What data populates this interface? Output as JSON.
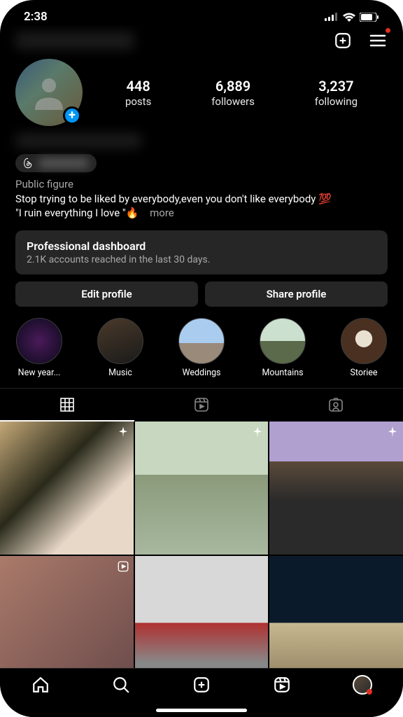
{
  "status": {
    "time": "2:38"
  },
  "stats": {
    "posts": {
      "count": "448",
      "label": "posts"
    },
    "followers": {
      "count": "6,889",
      "label": "followers"
    },
    "following": {
      "count": "3,237",
      "label": "following"
    }
  },
  "profile": {
    "category": "Public figure",
    "bio_line1": "Stop trying to be liked by everybody,even you don't like everybody 💯",
    "bio_line2": "\"I ruin everything I love \"🔥",
    "more_label": "more"
  },
  "dashboard": {
    "title": "Professional dashboard",
    "subtitle": "2.1K accounts reached in the last 30 days."
  },
  "actions": {
    "edit": "Edit profile",
    "share": "Share profile"
  },
  "highlights": [
    {
      "label": "New year..."
    },
    {
      "label": "Music"
    },
    {
      "label": "Weddings"
    },
    {
      "label": "Mountains"
    },
    {
      "label": "Storiee"
    }
  ]
}
